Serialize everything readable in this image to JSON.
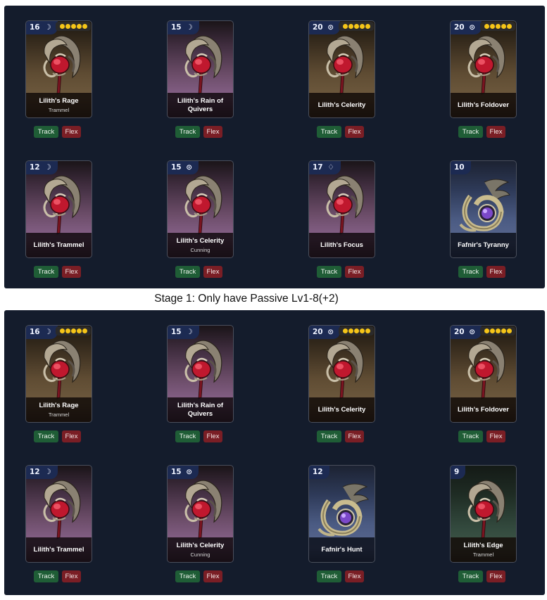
{
  "colors": {
    "panel_bg": "#141c2c",
    "badge_bg": "#1c2a52",
    "track_bg": "#1f5d36",
    "flex_bg": "#7a1e25",
    "star": "#f5c518"
  },
  "caption": "Stage 1: Only have Passive Lv1-8(+2)",
  "track_label": "Track",
  "flex_label": "Flex",
  "panels": [
    {
      "cards": [
        {
          "level": "16",
          "icon": "moon-icon",
          "glyph": "☽",
          "stars": true,
          "name": "Lilith's Rage",
          "sub": "Trammel",
          "bg": "gold",
          "art": "relic"
        },
        {
          "level": "15",
          "icon": "moon-icon",
          "glyph": "☽",
          "stars": false,
          "name": "Lilith's Rain of Quivers",
          "sub": "",
          "bg": "purple",
          "art": "relic"
        },
        {
          "level": "20",
          "icon": "circle-icon",
          "glyph": "⊙",
          "stars": true,
          "name": "Lilith's Celerity",
          "sub": "",
          "bg": "gold",
          "art": "relic"
        },
        {
          "level": "20",
          "icon": "circle-icon",
          "glyph": "⊙",
          "stars": true,
          "name": "Lilith's Foldover",
          "sub": "",
          "bg": "gold",
          "art": "relic"
        },
        {
          "level": "12",
          "icon": "moon-icon",
          "glyph": "☽",
          "stars": false,
          "name": "Lilith's Trammel",
          "sub": "",
          "bg": "purple",
          "art": "relic"
        },
        {
          "level": "15",
          "icon": "circle-icon",
          "glyph": "⊙",
          "stars": false,
          "name": "Lilith's Celerity",
          "sub": "Cunning",
          "bg": "purple",
          "art": "relic"
        },
        {
          "level": "17",
          "icon": "drop-icon",
          "glyph": "♢",
          "stars": false,
          "name": "Lilith's Focus",
          "sub": "",
          "bg": "purple",
          "art": "relic"
        },
        {
          "level": "10",
          "icon": "",
          "glyph": "",
          "stars": false,
          "name": "Fafnir's Tyranny",
          "sub": "",
          "bg": "blue",
          "art": "dragon"
        }
      ]
    },
    {
      "cards": [
        {
          "level": "16",
          "icon": "moon-icon",
          "glyph": "☽",
          "stars": true,
          "name": "Lilith's Rage",
          "sub": "Trammel",
          "bg": "gold",
          "art": "relic"
        },
        {
          "level": "15",
          "icon": "moon-icon",
          "glyph": "☽",
          "stars": false,
          "name": "Lilith's Rain of Quivers",
          "sub": "",
          "bg": "purple",
          "art": "relic"
        },
        {
          "level": "20",
          "icon": "circle-icon",
          "glyph": "⊙",
          "stars": true,
          "name": "Lilith's Celerity",
          "sub": "",
          "bg": "gold",
          "art": "relic"
        },
        {
          "level": "20",
          "icon": "circle-icon",
          "glyph": "⊙",
          "stars": true,
          "name": "Lilith's Foldover",
          "sub": "",
          "bg": "gold",
          "art": "relic"
        },
        {
          "level": "12",
          "icon": "moon-icon",
          "glyph": "☽",
          "stars": false,
          "name": "Lilith's Trammel",
          "sub": "",
          "bg": "purple",
          "art": "relic"
        },
        {
          "level": "15",
          "icon": "circle-icon",
          "glyph": "⊙",
          "stars": false,
          "name": "Lilith's Celerity",
          "sub": "Cunning",
          "bg": "purple",
          "art": "relic"
        },
        {
          "level": "12",
          "icon": "",
          "glyph": "",
          "stars": false,
          "name": "Fafnir's Hunt",
          "sub": "",
          "bg": "blue",
          "art": "dragon"
        },
        {
          "level": "9",
          "icon": "",
          "glyph": "",
          "stars": false,
          "name": "Lilith's Edge",
          "sub": "Trammel",
          "bg": "green",
          "art": "relic"
        }
      ]
    }
  ]
}
